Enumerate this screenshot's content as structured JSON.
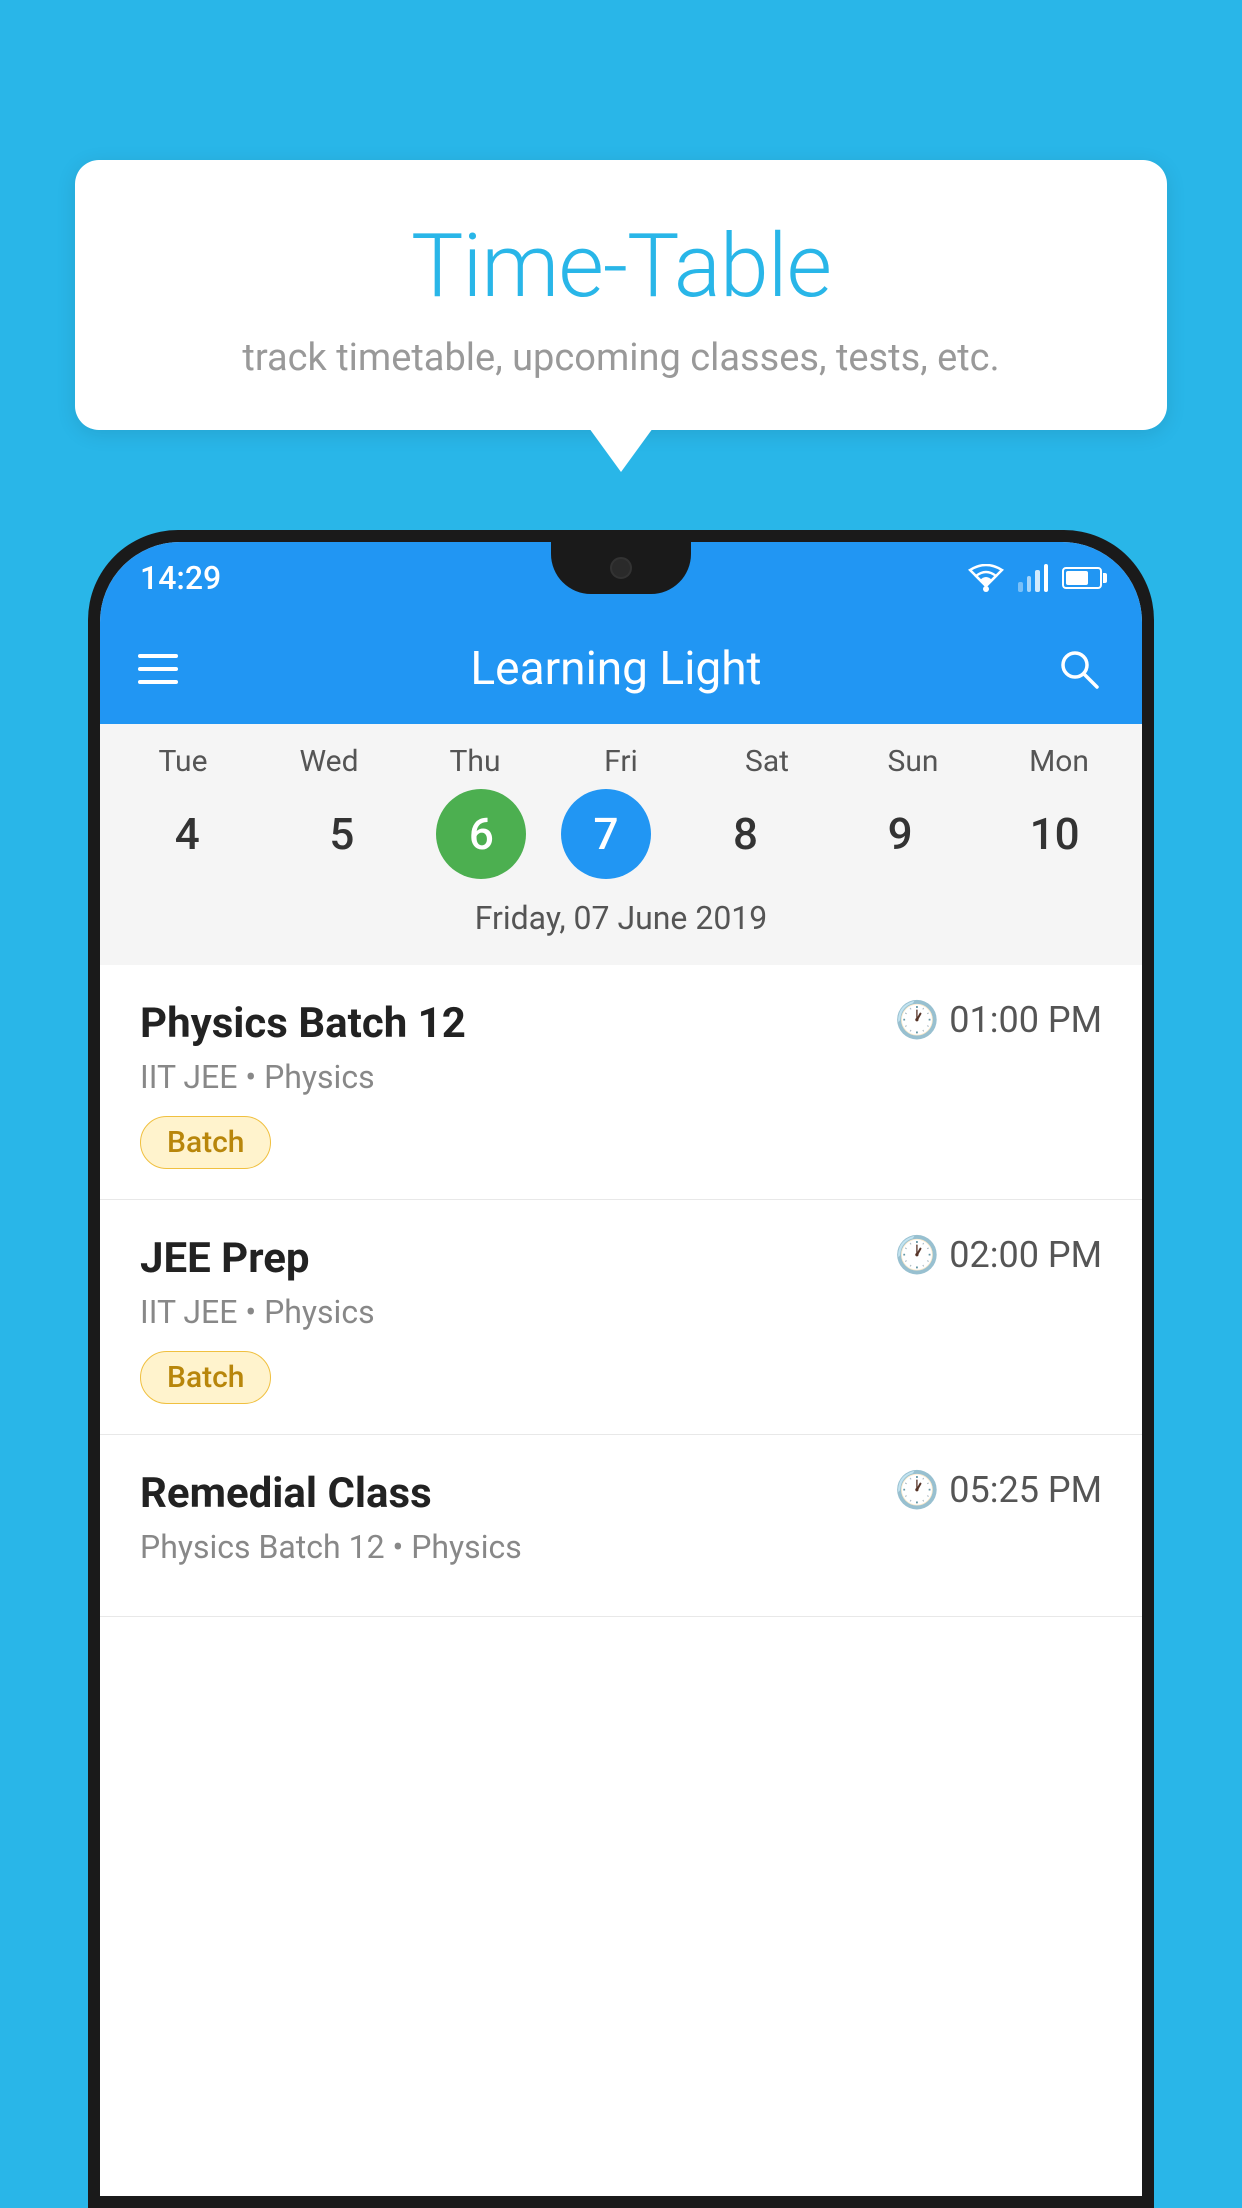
{
  "background": {
    "color": "#29B6E8"
  },
  "speech_bubble": {
    "title": "Time-Table",
    "subtitle": "track timetable, upcoming classes, tests, etc."
  },
  "phone": {
    "status_bar": {
      "time": "14:29"
    },
    "app_bar": {
      "title": "Learning Light"
    },
    "calendar": {
      "days": [
        {
          "short": "Tue",
          "num": "4"
        },
        {
          "short": "Wed",
          "num": "5"
        },
        {
          "short": "Thu",
          "num": "6"
        },
        {
          "short": "Fri",
          "num": "7"
        },
        {
          "short": "Sat",
          "num": "8"
        },
        {
          "short": "Sun",
          "num": "9"
        },
        {
          "short": "Mon",
          "num": "10"
        }
      ],
      "selected_date": "Friday, 07 June 2019"
    },
    "classes": [
      {
        "name": "Physics Batch 12",
        "time": "01:00 PM",
        "subtitle": "IIT JEE • Physics",
        "tag": "Batch"
      },
      {
        "name": "JEE Prep",
        "time": "02:00 PM",
        "subtitle": "IIT JEE • Physics",
        "tag": "Batch"
      },
      {
        "name": "Remedial Class",
        "time": "05:25 PM",
        "subtitle": "Physics Batch 12 • Physics",
        "tag": ""
      }
    ]
  }
}
